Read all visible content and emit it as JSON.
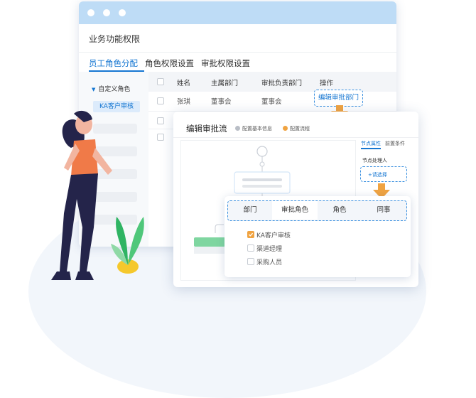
{
  "window": {
    "title": "业务功能权限",
    "tabs": [
      {
        "label": "员工角色分配",
        "active": true
      },
      {
        "label": "角色权限设置",
        "active": false
      },
      {
        "label": "审批权限设置",
        "active": false
      }
    ]
  },
  "sidebar": {
    "group_label": "自定义角色",
    "active_item": "KA客户审核"
  },
  "table": {
    "headers": [
      "姓名",
      "主属部门",
      "审批负责部门",
      "操作"
    ],
    "rows": [
      {
        "name": "张琪",
        "dept": "董事会",
        "approve_dept": "董事会",
        "action": "编辑审批部门"
      }
    ]
  },
  "modal": {
    "title": "编辑审批流",
    "steps": [
      {
        "label": "配置基本信息",
        "color": "#b9bec6"
      },
      {
        "label": "配置流程",
        "color": "#f0a341"
      }
    ],
    "right_tabs": [
      {
        "label": "节点属性",
        "active": true
      },
      {
        "label": "前置条件",
        "active": false
      }
    ],
    "node_handler_label": "节点处理人",
    "select_label": "+请选择"
  },
  "picker": {
    "tabs": [
      {
        "label": "部门",
        "active": false
      },
      {
        "label": "审批角色",
        "active": true
      },
      {
        "label": "角色",
        "active": false
      },
      {
        "label": "同事",
        "active": false
      }
    ],
    "items": [
      {
        "label": "KA客户审核",
        "checked": true
      },
      {
        "label": "渠道经理",
        "checked": false
      },
      {
        "label": "采购人员",
        "checked": false
      }
    ]
  },
  "colors": {
    "accent": "#1677d2",
    "highlight": "#f0a341",
    "titlebar": "#bedcf6"
  }
}
